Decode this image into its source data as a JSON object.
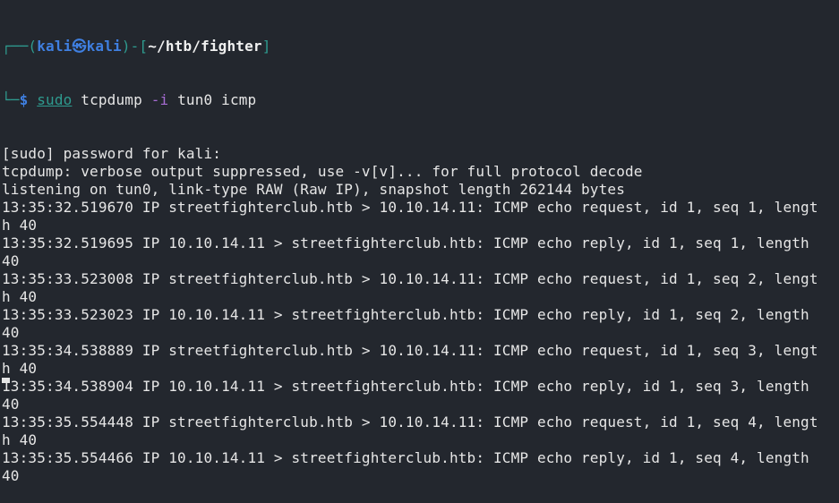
{
  "prompt": {
    "user": "kali",
    "separator_icon": "kali-dragon-icon",
    "host": "kali",
    "cwd": "~/htb/fighter",
    "symbol": "$",
    "command": "sudo",
    "program": "tcpdump",
    "flag": "-i",
    "args": "tun0 icmp"
  },
  "colors": {
    "background": "#23272e",
    "frame": "#2e9b8f",
    "user": "#3f7fe0",
    "flag": "#a66cd3",
    "text": "#e6e6e6"
  },
  "output": [
    "[sudo] password for kali:",
    "tcpdump: verbose output suppressed, use -v[v]... for full protocol decode",
    "listening on tun0, link-type RAW (Raw IP), snapshot length 262144 bytes",
    "13:35:32.519670 IP streetfighterclub.htb > 10.10.14.11: ICMP echo request, id 1, seq 1, lengt",
    "h 40",
    "13:35:32.519695 IP 10.10.14.11 > streetfighterclub.htb: ICMP echo reply, id 1, seq 1, length",
    "40",
    "13:35:33.523008 IP streetfighterclub.htb > 10.10.14.11: ICMP echo request, id 1, seq 2, lengt",
    "h 40",
    "13:35:33.523023 IP 10.10.14.11 > streetfighterclub.htb: ICMP echo reply, id 1, seq 2, length",
    "40",
    "13:35:34.538889 IP streetfighterclub.htb > 10.10.14.11: ICMP echo request, id 1, seq 3, lengt",
    "h 40",
    "13:35:34.538904 IP 10.10.14.11 > streetfighterclub.htb: ICMP echo reply, id 1, seq 3, length",
    "40",
    "13:35:35.554448 IP streetfighterclub.htb > 10.10.14.11: ICMP echo request, id 1, seq 4, lengt",
    "h 40",
    "13:35:35.554466 IP 10.10.14.11 > streetfighterclub.htb: ICMP echo reply, id 1, seq 4, length",
    "40"
  ]
}
